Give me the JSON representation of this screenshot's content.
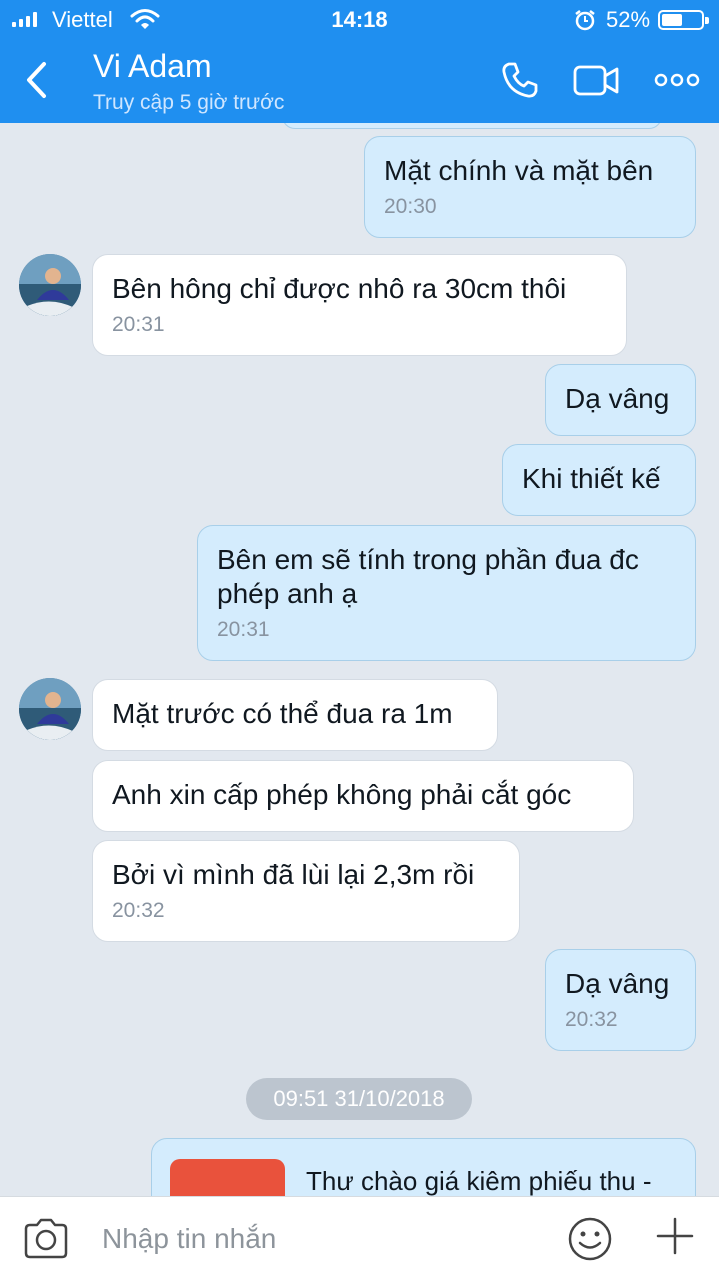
{
  "status_bar": {
    "carrier": "Viettel",
    "time": "14:18",
    "battery": "52%",
    "battery_level": 0.52
  },
  "header": {
    "contact_name": "Vi Adam",
    "last_seen": "Truy cập 5 giờ trước"
  },
  "messages": [
    {
      "dir": "out",
      "text": "Mặt chính và mặt bên",
      "time": "20:30"
    },
    {
      "dir": "in",
      "text": "Bên hông chỉ được nhô ra 30cm thôi",
      "time": "20:31"
    },
    {
      "dir": "out",
      "text": "Dạ vâng"
    },
    {
      "dir": "out",
      "text": "Khi thiết kế"
    },
    {
      "dir": "out",
      "text": "Bên em sẽ tính trong phần đua đc phép anh ạ",
      "time": "20:31"
    },
    {
      "dir": "in",
      "text": "Mặt trước có thể đua ra 1m"
    },
    {
      "dir": "in",
      "text": "Anh xin cấp phép không phải cắt góc"
    },
    {
      "dir": "in",
      "text": "Bởi vì mình đã lùi lại 2,3m rồi",
      "time": "20:32"
    },
    {
      "dir": "out",
      "text": "Dạ vâng",
      "time": "20:32"
    }
  ],
  "date_separator": "09:51 31/10/2018",
  "file_message": {
    "name": "Thư chào giá kiêm phiếu thu -"
  },
  "composer": {
    "placeholder": "Nhập tin nhắn"
  },
  "colors": {
    "header": "#1f8ff0",
    "outgoing_bubble": "#d4ecfd",
    "incoming_bubble": "#ffffff",
    "background": "#e2e8ef"
  },
  "icons": [
    "back-icon",
    "phone-icon",
    "video-call-icon",
    "more-icon",
    "camera-icon",
    "emoji-icon",
    "plus-icon"
  ]
}
